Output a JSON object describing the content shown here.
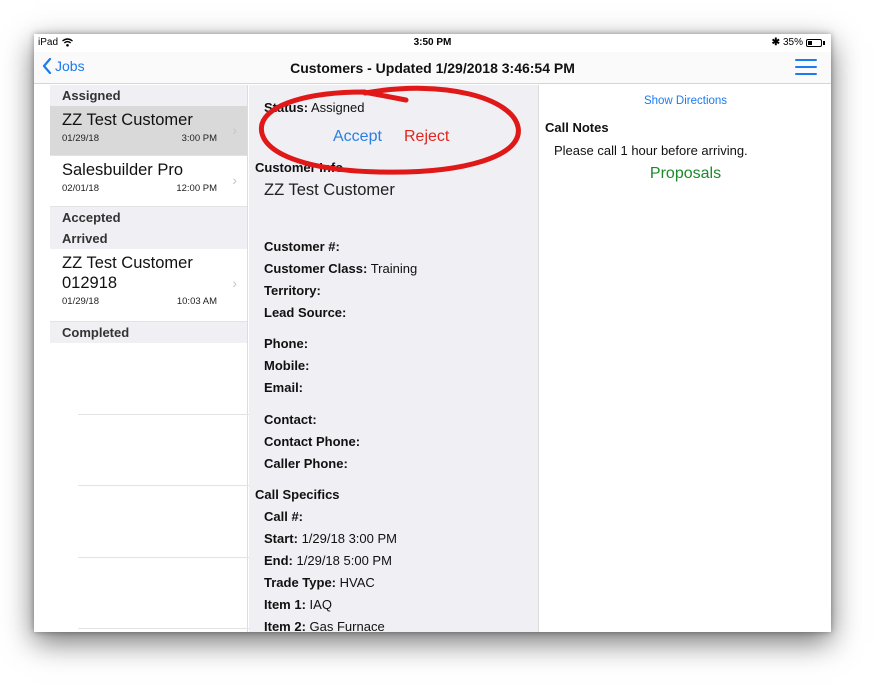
{
  "statusbar": {
    "device": "iPad",
    "time": "3:50 PM",
    "battery": "35%",
    "battery_level": 0.35
  },
  "navbar": {
    "back_label": "Jobs",
    "title": "Customers - Updated 1/29/2018 3:46:54 PM"
  },
  "jobs": {
    "assigned_header": "Assigned",
    "assigned": [
      {
        "title": "ZZ Test Customer",
        "date": "01/29/18",
        "time": "3:00 PM"
      },
      {
        "title": "Salesbuilder Pro",
        "date": "02/01/18",
        "time": "12:00 PM"
      }
    ],
    "accepted_header": "Accepted",
    "arrived_header": "Arrived",
    "arrived": [
      {
        "title_line1": "ZZ Test Customer",
        "title_line2": "012918",
        "date": "01/29/18",
        "time": "10:03 AM"
      }
    ],
    "completed_header": "Completed"
  },
  "detail": {
    "status_label": "Status:",
    "status_value": "Assigned",
    "accept_label": "Accept",
    "reject_label": "Reject",
    "customer_info_header": "Customer Info",
    "customer_name": "ZZ Test Customer",
    "customer_num_label": "Customer #:",
    "customer_class_label": "Customer Class:",
    "customer_class_value": "Training",
    "territory_label": "Territory:",
    "lead_source_label": "Lead Source:",
    "phone_label": "Phone:",
    "mobile_label": "Mobile:",
    "email_label": "Email:",
    "contact_label": "Contact:",
    "contact_phone_label": "Contact Phone:",
    "caller_phone_label": "Caller Phone:",
    "call_specifics_header": "Call Specifics",
    "call_num_label": "Call #:",
    "start_label": "Start:",
    "start_value": "1/29/18 3:00 PM",
    "end_label": "End:",
    "end_value": "1/29/18 5:00 PM",
    "trade_type_label": "Trade Type:",
    "trade_type_value": "HVAC",
    "item1_label": "Item 1:",
    "item1_value": "IAQ",
    "item2_label": "Item 2:",
    "item2_value": "Gas Furnace"
  },
  "notes": {
    "show_directions": "Show Directions",
    "call_notes_label": "Call Notes",
    "call_notes_text": "Please call 1 hour before arriving.",
    "proposals_label": "Proposals"
  },
  "colors": {
    "accent": "#1a7cf0",
    "reject": "#e0261f",
    "proposals": "#1b8a2b",
    "annotation": "#e01818"
  }
}
